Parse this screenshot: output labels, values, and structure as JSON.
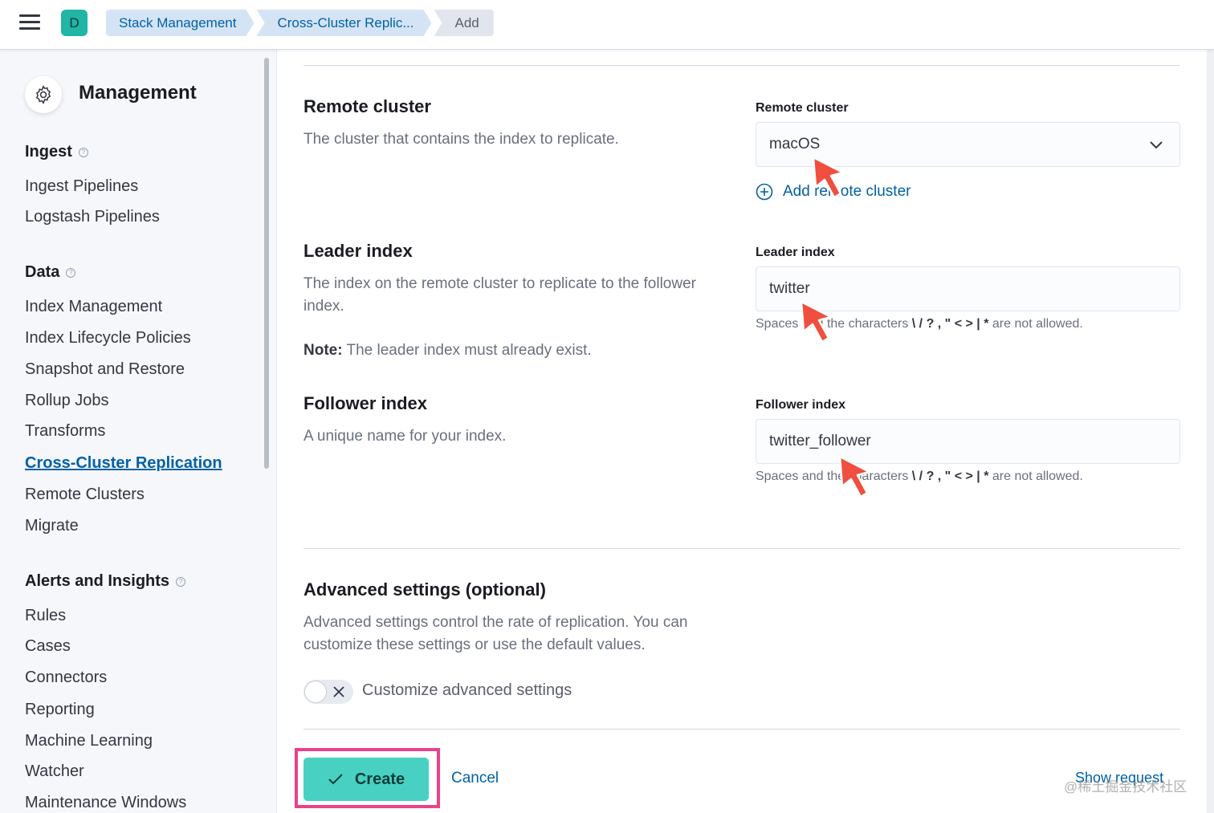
{
  "header": {
    "space_initial": "D",
    "breadcrumbs": [
      "Stack Management",
      "Cross-Cluster Replic...",
      "Add"
    ]
  },
  "sidebar": {
    "title": "Management",
    "groups": [
      {
        "title": "Ingest",
        "items": [
          "Ingest Pipelines",
          "Logstash Pipelines"
        ]
      },
      {
        "title": "Data",
        "items": [
          "Index Management",
          "Index Lifecycle Policies",
          "Snapshot and Restore",
          "Rollup Jobs",
          "Transforms",
          "Cross-Cluster Replication",
          "Remote Clusters",
          "Migrate"
        ]
      },
      {
        "title": "Alerts and Insights",
        "items": [
          "Rules",
          "Cases",
          "Connectors",
          "Reporting",
          "Machine Learning",
          "Watcher",
          "Maintenance Windows"
        ]
      }
    ],
    "active_item": "Cross-Cluster Replication"
  },
  "form": {
    "remote_cluster": {
      "title": "Remote cluster",
      "description": "The cluster that contains the index to replicate.",
      "field_label": "Remote cluster",
      "value": "macOS",
      "add_link": "Add remote cluster"
    },
    "leader_index": {
      "title": "Leader index",
      "description": "The index on the remote cluster to replicate to the follower index.",
      "note_label": "Note:",
      "note_text": " The leader index must already exist.",
      "field_label": "Leader index",
      "value": "twitter",
      "help_prefix": "Spaces and the characters ",
      "help_chars": "\\ / ? , \" < > | *",
      "help_suffix": " are not allowed."
    },
    "follower_index": {
      "title": "Follower index",
      "description": "A unique name for your index.",
      "field_label": "Follower index",
      "value": "twitter_follower",
      "help_prefix": "Spaces and the characters ",
      "help_chars": "\\ / ? , \" < > | *",
      "help_suffix": " are not allowed."
    },
    "advanced": {
      "title": "Advanced settings (optional)",
      "description": "Advanced settings control the rate of replication. You can customize these settings or use the default values.",
      "toggle_label": "Customize advanced settings",
      "toggle_on": false
    }
  },
  "actions": {
    "create": "Create",
    "cancel": "Cancel",
    "show_request": "Show request"
  },
  "watermark": "@稀土掘金技术社区",
  "colors": {
    "accent": "#0061a6",
    "primary_button": "#48d1c3",
    "highlight": "#e8428a",
    "annotation_arrow": "#f04e3e"
  }
}
